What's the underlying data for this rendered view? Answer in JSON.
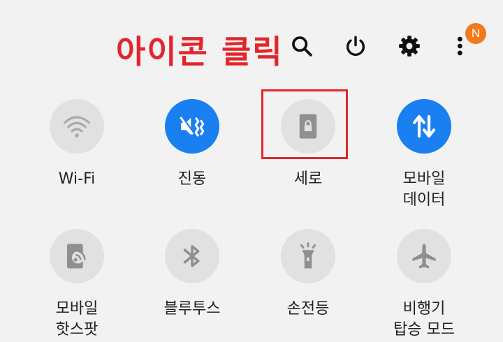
{
  "annotation": "아이콘 클릭",
  "header": {
    "badge": "N",
    "icons": [
      "search-icon",
      "power-icon",
      "gear-icon",
      "more-vertical-icon"
    ]
  },
  "tiles": [
    {
      "label": "Wi-Fi",
      "icon": "wifi-icon",
      "active": false
    },
    {
      "label": "진동",
      "icon": "vibrate-icon",
      "active": true
    },
    {
      "label": "세로",
      "icon": "portrait-lock-icon",
      "active": false
    },
    {
      "label": "모바일\n데이터",
      "icon": "mobile-data-icon",
      "active": true
    },
    {
      "label": "모바일\n핫스팟",
      "icon": "hotspot-icon",
      "active": false
    },
    {
      "label": "블루투스",
      "icon": "bluetooth-icon",
      "active": false
    },
    {
      "label": "손전등",
      "icon": "flashlight-icon",
      "active": false
    },
    {
      "label": "비행기\n탑승 모드",
      "icon": "airplane-icon",
      "active": false
    }
  ],
  "colors": {
    "accent": "#1a7ff1",
    "annotation": "#e2262b",
    "badge": "#f07a1c",
    "inactive": "#e1e1e1"
  }
}
